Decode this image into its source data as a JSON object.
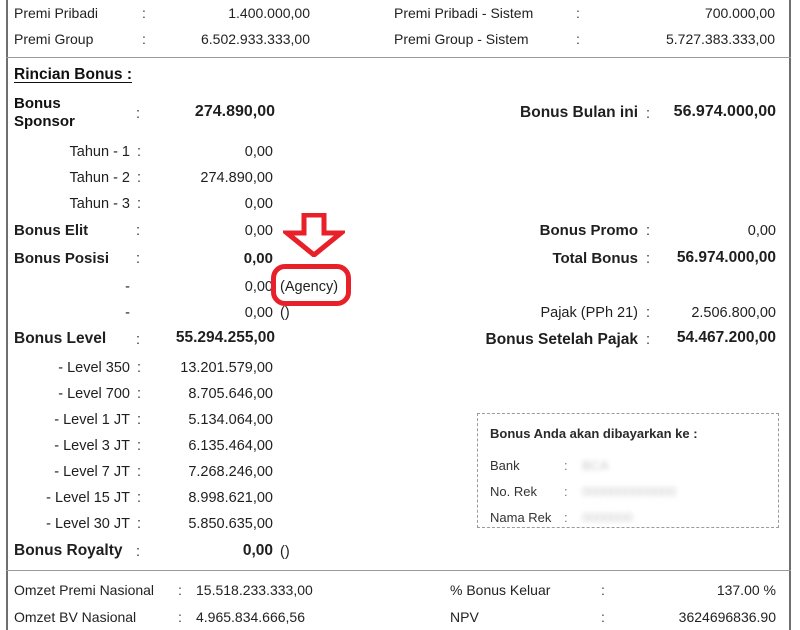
{
  "document": {
    "section_heading": "Rincian Bonus :",
    "colon": ":"
  },
  "header_band": {
    "left": [
      {
        "label": "Premi Pribadi",
        "value": "1.400.000,00"
      },
      {
        "label": "Premi Group",
        "value": "6.502.933.333,00"
      }
    ],
    "right": [
      {
        "label": "Premi Pribadi - Sistem",
        "value": "700.000,00"
      },
      {
        "label": "Premi Group - Sistem",
        "value": "5.727.383.333,00"
      }
    ]
  },
  "bonus_left": {
    "sponsor": {
      "label": "Bonus\nSponsor",
      "value": "274.890,00"
    },
    "sponsor_years": [
      {
        "label": "Tahun - 1",
        "value": "0,00"
      },
      {
        "label": "Tahun - 2",
        "value": "274.890,00"
      },
      {
        "label": "Tahun - 3",
        "value": "0,00"
      }
    ],
    "elit": {
      "label": "Bonus Elit",
      "value": "0,00"
    },
    "posisi": {
      "label": "Bonus Posisi",
      "value": "0,00"
    },
    "posisi_subitems": [
      {
        "label": "-",
        "value": "0,00",
        "suffix": "(Agency)"
      },
      {
        "label": "-",
        "value": "0,00",
        "suffix": "()"
      }
    ],
    "level": {
      "label": "Bonus Level",
      "value": "55.294.255,00"
    },
    "level_items": [
      {
        "label": "- Level 350",
        "value": "13.201.579,00"
      },
      {
        "label": "- Level 700",
        "value": "8.705.646,00"
      },
      {
        "label": "- Level 1 JT",
        "value": "5.134.064,00"
      },
      {
        "label": "- Level 3 JT",
        "value": "6.135.464,00"
      },
      {
        "label": "- Level 7 JT",
        "value": "7.268.246,00"
      },
      {
        "label": "- Level 15 JT",
        "value": "8.998.621,00"
      },
      {
        "label": "- Level 30 JT",
        "value": "5.850.635,00"
      }
    ],
    "royalty": {
      "label": "Bonus Royalty",
      "value": "0,00",
      "suffix": "()"
    }
  },
  "bonus_right": {
    "bulan_ini": {
      "label": "Bonus Bulan ini",
      "value": "56.974.000,00"
    },
    "promo": {
      "label": "Bonus Promo",
      "value": "0,00"
    },
    "total": {
      "label": "Total Bonus",
      "value": "56.974.000,00"
    },
    "pajak": {
      "label": "Pajak (PPh 21)",
      "value": "2.506.800,00"
    },
    "setelah_pajak": {
      "label": "Bonus Setelah Pajak",
      "value": "54.467.200,00"
    }
  },
  "payout_box": {
    "title": "Bonus Anda akan dibayarkan ke :",
    "rows": [
      {
        "label": "Bank",
        "value": "BCA"
      },
      {
        "label": "No. Rek",
        "value": "0000000000000"
      },
      {
        "label": "Nama Rek",
        "value": "0000000"
      }
    ]
  },
  "footer_band": {
    "left": [
      {
        "label": "Omzet Premi Nasional",
        "value": "15.518.233.333,00"
      },
      {
        "label": "Omzet BV Nasional",
        "value": "4.965.834.666,56"
      }
    ],
    "right": [
      {
        "label": "% Bonus Keluar",
        "value": "137.00 %"
      },
      {
        "label": "NPV",
        "value": "3624696836.90"
      }
    ]
  },
  "annotations": {
    "arrow": {
      "name": "red-down-arrow",
      "color": "#e8202a",
      "points_at": "(Agency)"
    },
    "highlight_box": {
      "name": "red-rounded-highlight",
      "color": "#e8202a",
      "encloses": "(Agency)"
    }
  }
}
